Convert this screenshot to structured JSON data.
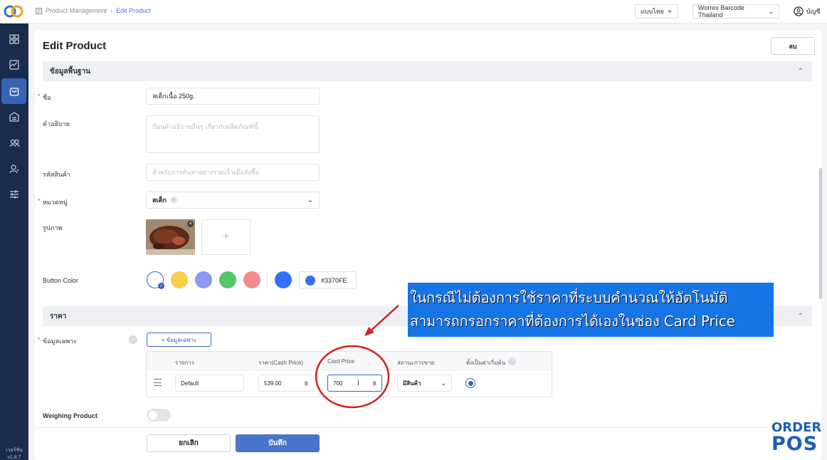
{
  "breadcrumb": {
    "parent": "Product Management",
    "current": "Edit Product"
  },
  "topbar": {
    "language": "แบบไทย",
    "store": "Worrex Barcode Thailand",
    "account": "บัญชี"
  },
  "sidebar": {
    "items": [
      {
        "icon": "grid-icon"
      },
      {
        "icon": "dashboard-icon"
      },
      {
        "icon": "shopping-bag-icon",
        "active": true
      },
      {
        "icon": "warehouse-icon"
      },
      {
        "icon": "customers-icon"
      },
      {
        "icon": "user-icon"
      },
      {
        "icon": "settings-sliders-icon"
      }
    ],
    "version_label": "เวอร์ชัน",
    "version": "v1.8.7"
  },
  "page": {
    "title": "Edit Product",
    "delete_label": "ลบ"
  },
  "basic_section": {
    "title": "ข้อมูลพื้นฐาน",
    "name_label": "ชื่อ",
    "name_value": "สเต็กเนื้อ 250g.",
    "description_label": "คำอธิบาย",
    "description_placeholder": "ป้อนคำอธิบายอื่นๆ เกี่ยวกับผลิตภัณฑ์นี้",
    "sku_label": "รหัสสินค้า",
    "sku_placeholder": "สำหรับการค้นหาอย่างรวดเร็วเมื่อสั่งซื้อ",
    "category_label": "หมวดหมู่",
    "category_value": "สเต็ก",
    "image_label": "รูปภาพ",
    "button_color_label": "Button Color",
    "colors": [
      "#ffffff",
      "#f7d046",
      "#8d99f2",
      "#58c46b",
      "#f28b8f",
      "#3370fe"
    ],
    "selected_color": "#3370FE"
  },
  "price_section": {
    "title": "ราคา",
    "option_label": "ข้อมูลเฉพาะ",
    "add_option_button": "+ ข้อมูลเฉพาะ",
    "table": {
      "headers": [
        "รายการ",
        "ราคา(Cash Price)",
        "Card Price",
        "สถานะการขาย",
        "ตั้งเป็นค่าเริ่มต้น"
      ],
      "rows": [
        {
          "name": "Default",
          "cash_price": "539.00",
          "card_price": "700",
          "currency": "฿",
          "status": "มีสินค้า",
          "is_default": true
        }
      ]
    },
    "weighing_label": "Weighing Product",
    "weighing_enabled": false
  },
  "annotation": {
    "line1": "ในกรณีไม่ต้องการใช้ราคาที่ระบบคำนวณให้อัตโนมัติ",
    "line2": "สามารถกรอกราคาที่ต้องการได้เองในช่อง Card Price",
    "color": "#1575e6",
    "circle_color": "#d32020"
  },
  "footer": {
    "cancel_label": "ยกเลิก",
    "save_label": "บันทึก",
    "save_color": "#4a74c9"
  },
  "brand": {
    "line1": "ORDER",
    "line2": "POS"
  }
}
